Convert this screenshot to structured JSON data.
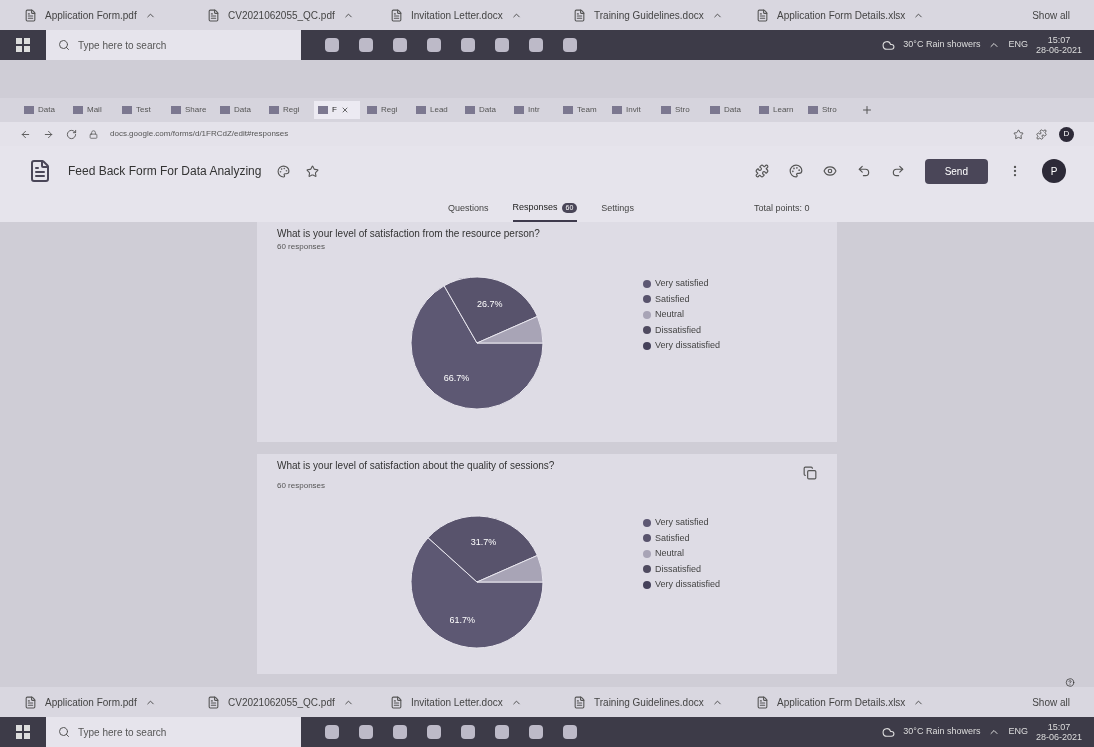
{
  "top_downloads": {
    "files": [
      "Application Form.pdf",
      "CV2021062055_QC.pdf",
      "Invitation Letter.docx",
      "Training Guidelines.docx",
      "Application Form Details.xlsx"
    ],
    "show_all": "Show all"
  },
  "top_taskbar": {
    "search": "Type here to search",
    "weather": "30°C Rain showers",
    "lang": "ENG",
    "time": "15:07",
    "date": "28-06-2021"
  },
  "browser": {
    "tabs": [
      {
        "label": "Data",
        "selected": false
      },
      {
        "label": "Mail",
        "selected": false
      },
      {
        "label": "Test",
        "selected": false
      },
      {
        "label": "Share",
        "selected": false
      },
      {
        "label": "Data",
        "selected": false
      },
      {
        "label": "Regi",
        "selected": false
      },
      {
        "label": "F",
        "selected": true
      },
      {
        "label": "Regi",
        "selected": false
      },
      {
        "label": "Lead",
        "selected": false
      },
      {
        "label": "Data",
        "selected": false
      },
      {
        "label": "Intr",
        "selected": false
      },
      {
        "label": "Team",
        "selected": false
      },
      {
        "label": "Invit",
        "selected": false
      },
      {
        "label": "Stro",
        "selected": false
      },
      {
        "label": "Data",
        "selected": false
      },
      {
        "label": "Learn",
        "selected": false
      },
      {
        "label": "Stro",
        "selected": false
      }
    ],
    "url": "docs.google.com/forms/d/1FRCdZ/edit#responses",
    "profile": "D"
  },
  "form": {
    "title": "Feed Back Form For Data Analyzing",
    "send": "Send",
    "avatar": "P",
    "nav": [
      {
        "label": "Questions",
        "selected": false
      },
      {
        "label": "Responses",
        "badge": "60",
        "selected": true
      },
      {
        "label": "Settings",
        "selected": false
      }
    ],
    "total_points": "Total points: 0"
  },
  "questions": [
    {
      "title": "What is your level of satisfaction from the resource person?",
      "responses": "60 responses",
      "copy_icon": false,
      "chart_data": {
        "type": "pie",
        "categories": [
          "Very satisfied",
          "Satisfied",
          "Neutral",
          "Dissatisfied",
          "Very dissatisfied"
        ],
        "series": [
          {
            "values": [
              66.7,
              26.7,
              6.6,
              0,
              0
            ]
          }
        ],
        "colors": [
          "#5d5873",
          "#58536c",
          "#a8a4b6",
          "#4f4b60",
          "#45415a"
        ],
        "value_labels": [
          "66.7%",
          "26.7%",
          null,
          null,
          null
        ],
        "legend": true
      }
    },
    {
      "title": "What is your level of satisfaction about the quality of sessions?",
      "responses": "60 responses",
      "copy_icon": true,
      "chart_data": {
        "type": "pie",
        "categories": [
          "Very satisfied",
          "Satisfied",
          "Neutral",
          "Dissatisfied",
          "Very dissatisfied"
        ],
        "series": [
          {
            "values": [
              61.7,
              31.7,
              6.6,
              0,
              0
            ]
          }
        ],
        "colors": [
          "#5d5873",
          "#58536c",
          "#a8a4b6",
          "#4f4b60",
          "#45415a"
        ],
        "value_labels": [
          "61.7%",
          "31.7%",
          null,
          null,
          null
        ],
        "legend": true
      }
    }
  ],
  "bottom_downloads": {
    "files": [
      "Application Form.pdf",
      "CV2021062055_QC.pdf",
      "Invitation Letter.docx",
      "Training Guidelines.docx",
      "Application Form Details.xlsx"
    ],
    "show_all": "Show all"
  },
  "bottom_taskbar": {
    "search": "Type here to search",
    "weather": "30°C Rain showers",
    "lang": "ENG",
    "time": "15:07",
    "date": "28-06-2021"
  }
}
